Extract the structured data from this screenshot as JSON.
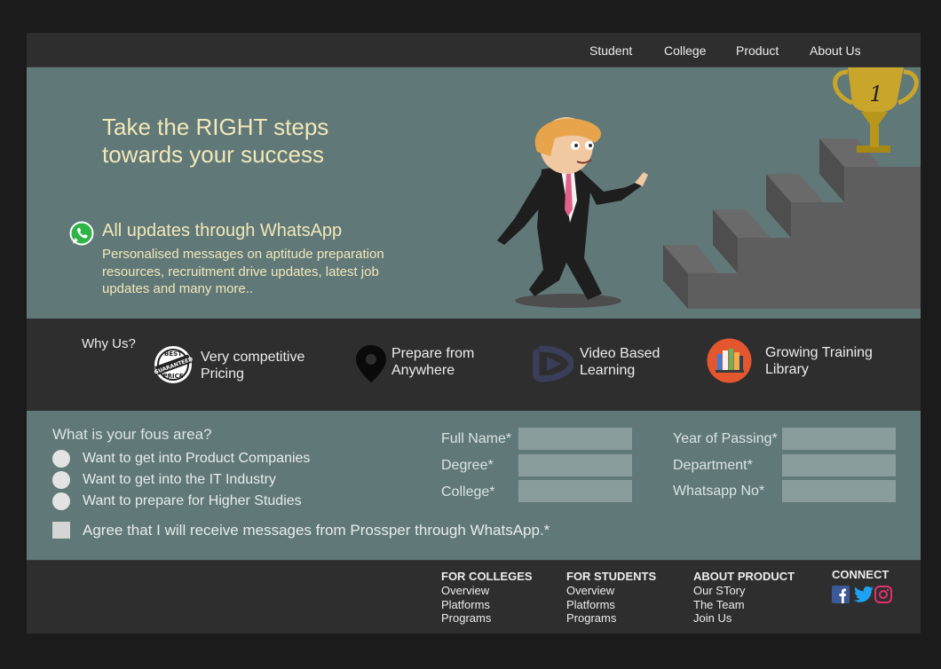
{
  "nav": {
    "items": [
      "Student",
      "College",
      "Product",
      "About Us"
    ]
  },
  "hero": {
    "title": "Take the RIGHT steps towards your success",
    "whatsapp_title": "All updates through WhatsApp",
    "whatsapp_desc": "Personalised messages on aptitude preparation resources, recruitment drive updates, latest job updates and many more..",
    "trophy_number": "1",
    "colors": {
      "background": "#617878",
      "text": "#f1e8b8"
    }
  },
  "why": {
    "label": "Why Us?",
    "features": [
      {
        "label": "Very competitive Pricing",
        "icon": "best-price-badge-icon",
        "badge_top": "BEST",
        "badge_mid": "GUARANTEED",
        "badge_bottom": "PRICE"
      },
      {
        "label": "Prepare from Anywhere",
        "icon": "map-pin-icon"
      },
      {
        "label": "Video Based Learning",
        "icon": "video-play-icon"
      },
      {
        "label": "Growing Training Library",
        "icon": "library-books-icon"
      }
    ]
  },
  "form": {
    "question": "What is your fous area?",
    "options": [
      "Want to get into Product Companies",
      "Want to get into the IT Industry",
      "Want to prepare for Higher Studies"
    ],
    "agree": "Agree that I will receive messages from Prossper through WhatsApp.*",
    "fields_left": [
      {
        "label": "Full Name*",
        "value": ""
      },
      {
        "label": "Degree*",
        "value": ""
      },
      {
        "label": "College*",
        "value": ""
      }
    ],
    "fields_right": [
      {
        "label": "Year of Passing*",
        "value": ""
      },
      {
        "label": "Department*",
        "value": ""
      },
      {
        "label": "Whatsapp No*",
        "value": ""
      }
    ]
  },
  "footer": {
    "columns": [
      {
        "heading": "FOR COLLEGES",
        "links": [
          "Overview",
          "Platforms",
          "Programs"
        ]
      },
      {
        "heading": "FOR STUDENTS",
        "links": [
          "Overview",
          "Platforms",
          "Programs"
        ]
      },
      {
        "heading": "ABOUT PRODUCT",
        "links": [
          "Our STory",
          "The Team",
          "Join Us"
        ]
      }
    ],
    "connect": {
      "heading": "CONNECT",
      "icons": [
        "facebook-icon",
        "twitter-icon",
        "instagram-icon"
      ]
    }
  }
}
